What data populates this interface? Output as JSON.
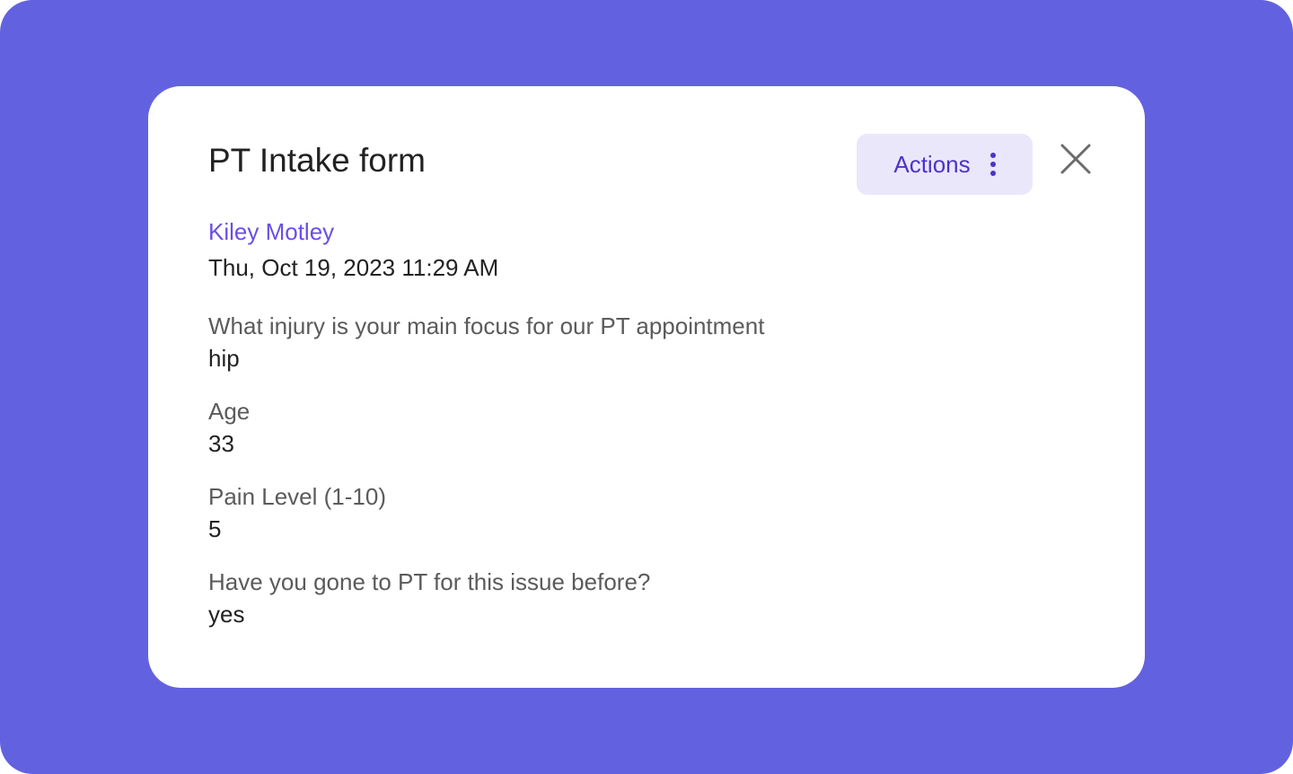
{
  "modal": {
    "title": "PT Intake form",
    "actions_label": "Actions",
    "patient_name": "Kiley Motley",
    "timestamp": "Thu, Oct 19, 2023 11:29 AM",
    "questions": [
      {
        "question": "What injury is your main focus for our PT appointment",
        "answer": "hip"
      },
      {
        "question": "Age",
        "answer": "33"
      },
      {
        "question": "Pain Level (1-10)",
        "answer": "5"
      },
      {
        "question": "Have you gone to PT for this issue before?",
        "answer": "yes"
      }
    ]
  },
  "icons": {
    "actions_menu": "kebab-menu-icon",
    "close": "close-icon"
  },
  "colors": {
    "backdrop": "#6262e0",
    "accent": "#6a4fe6",
    "button_bg": "#ebe7fb",
    "button_text": "#4a34c9"
  }
}
